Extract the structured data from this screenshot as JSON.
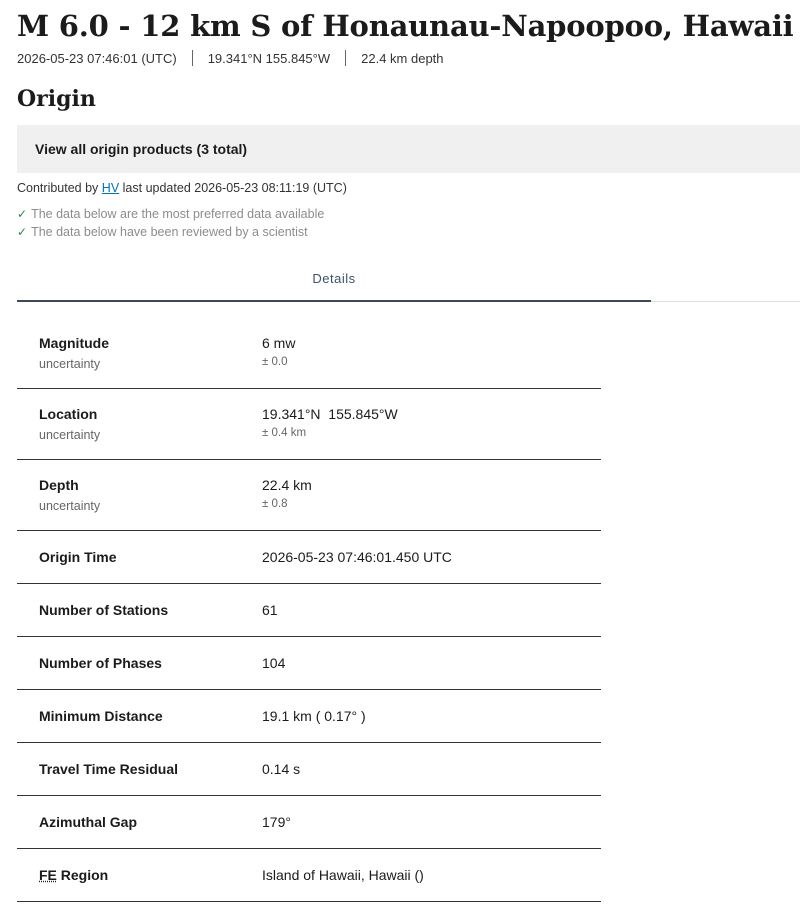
{
  "header": {
    "title": "M 6.0 - 12 km S of Honaunau-Napoopoo, Hawaii",
    "time": "2026-05-23 07:46:01 (UTC)",
    "coordinates": "19.341°N 155.845°W",
    "depth": "22.4 km depth"
  },
  "origin": {
    "section_title": "Origin",
    "products_link": "View all origin products (3 total)",
    "contributed_prefix": "Contributed by",
    "contributor": "HV",
    "last_updated": "last updated 2026-05-23 08:11:19 (UTC)",
    "preferred_note": "The data below are the most preferred data available",
    "reviewed_note": "The data below have been reviewed by a scientist"
  },
  "tabs": {
    "details": "Details"
  },
  "details": {
    "magnitude": {
      "label": "Magnitude",
      "sub": "uncertainty",
      "value": "6 mw",
      "uncertainty": "± 0.0"
    },
    "location": {
      "label": "Location",
      "sub": "uncertainty",
      "value": "19.341°N  155.845°W",
      "uncertainty": "± 0.4 km"
    },
    "depth": {
      "label": "Depth",
      "sub": "uncertainty",
      "value": "22.4 km",
      "uncertainty": "± 0.8"
    },
    "origin_time": {
      "label": "Origin Time",
      "value": "2026-05-23 07:46:01.450 UTC"
    },
    "stations": {
      "label": "Number of Stations",
      "value": "61"
    },
    "phases": {
      "label": "Number of Phases",
      "value": "104"
    },
    "min_distance": {
      "label": "Minimum Distance",
      "value": "19.1 km ( 0.17° )"
    },
    "residual": {
      "label": "Travel Time Residual",
      "value": "0.14 s"
    },
    "azimuthal_gap": {
      "label": "Azimuthal Gap",
      "value": "179°"
    },
    "fe_region": {
      "label_abbr": "FE",
      "label_rest": " Region",
      "value": "Island of Hawaii, Hawaii ()"
    }
  },
  "icons": {
    "check": "check-icon"
  },
  "colors": {
    "check": "#2e8540",
    "link": "#0071bc",
    "tab_active": "#3b4a5a"
  }
}
